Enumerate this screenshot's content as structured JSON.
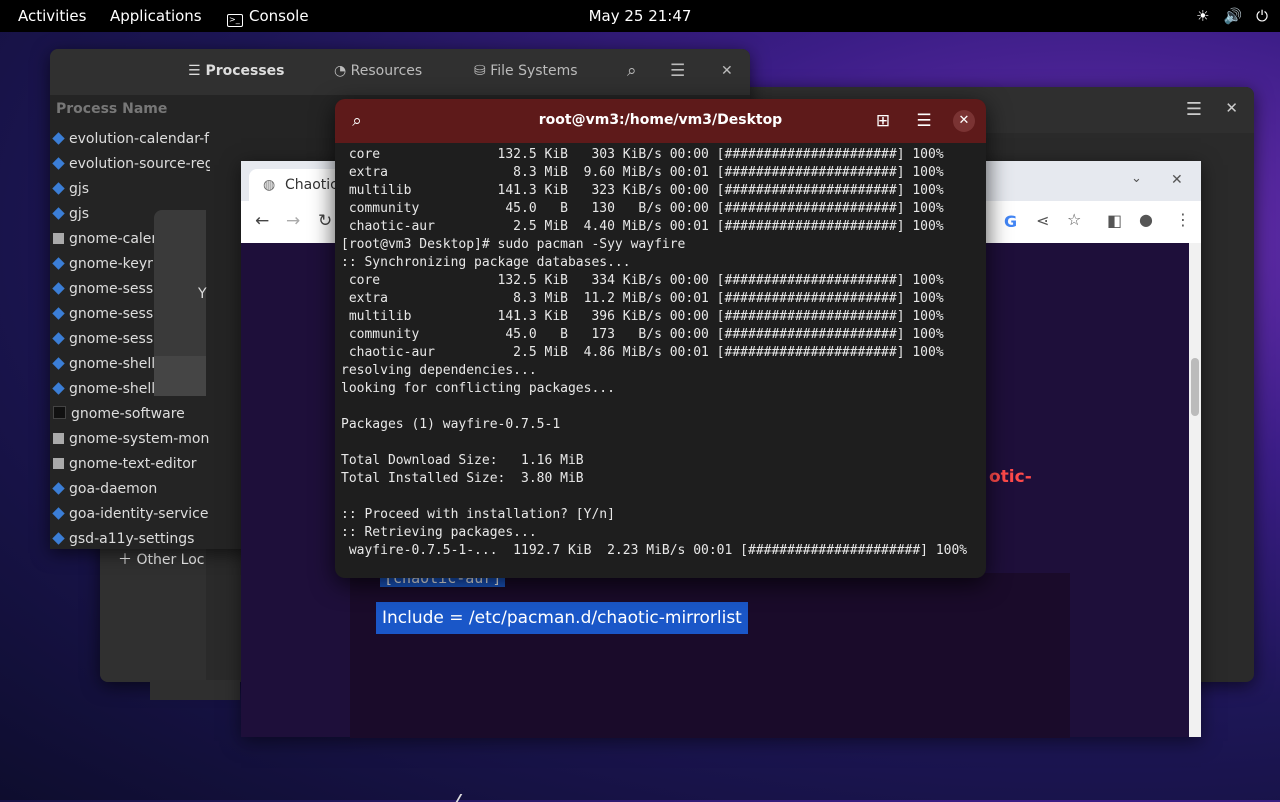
{
  "topbar": {
    "activities": "Activities",
    "applications": "Applications",
    "console": "Console",
    "clock": "May 25  21:47",
    "tray_icons": [
      "brightness-icon",
      "volume-icon",
      "power-icon"
    ]
  },
  "sysmon": {
    "tabs": [
      "Processes",
      "Resources",
      "File Systems"
    ],
    "column_header": "Process Name",
    "processes": [
      {
        "name": "evolution-calendar-f",
        "icon": "diamond"
      },
      {
        "name": "evolution-source-reg",
        "icon": "diamond"
      },
      {
        "name": "gjs",
        "icon": "diamond"
      },
      {
        "name": "gjs",
        "icon": "diamond"
      },
      {
        "name": "gnome-calen",
        "icon": "square"
      },
      {
        "name": "gnome-keyri",
        "icon": "diamond"
      },
      {
        "name": "gnome-sessi",
        "icon": "diamond"
      },
      {
        "name": "gnome-sessi",
        "icon": "diamond"
      },
      {
        "name": "gnome-sessi",
        "icon": "diamond"
      },
      {
        "name": "gnome-shell",
        "icon": "diamond"
      },
      {
        "name": "gnome-shell-c",
        "icon": "diamond"
      },
      {
        "name": "gnome-software",
        "icon": "black"
      },
      {
        "name": "gnome-system-moni",
        "icon": "square"
      },
      {
        "name": "gnome-text-editor",
        "icon": "square"
      },
      {
        "name": "goa-daemon",
        "icon": "diamond"
      },
      {
        "name": "goa-identity-service",
        "icon": "diamond"
      },
      {
        "name": "gsd-a11y-settings",
        "icon": "diamond"
      }
    ]
  },
  "files": {
    "other_locations": "Other Loc",
    "dialog_fragment": "Y"
  },
  "browser": {
    "tab_title": "Chaotic",
    "red_fragment": "otic-",
    "highlight1": "[chaotic-aur]",
    "highlight2": "Include = /etc/pacman.d/chaotic-mirrorlist"
  },
  "terminal": {
    "title": "root@vm3:/home/vm3/Desktop",
    "output": " core               132.5 KiB   303 KiB/s 00:00 [######################] 100%\n extra                8.3 MiB  9.60 MiB/s 00:01 [######################] 100%\n multilib           141.3 KiB   323 KiB/s 00:00 [######################] 100%\n community           45.0   B   130   B/s 00:00 [######################] 100%\n chaotic-aur          2.5 MiB  4.40 MiB/s 00:01 [######################] 100%\n[root@vm3 Desktop]# sudo pacman -Syy wayfire\n:: Synchronizing package databases...\n core               132.5 KiB   334 KiB/s 00:00 [######################] 100%\n extra                8.3 MiB  11.2 MiB/s 00:01 [######################] 100%\n multilib           141.3 KiB   396 KiB/s 00:00 [######################] 100%\n community           45.0   B   173   B/s 00:00 [######################] 100%\n chaotic-aur          2.5 MiB  4.86 MiB/s 00:01 [######################] 100%\nresolving dependencies...\nlooking for conflicting packages...\n\nPackages (1) wayfire-0.7.5-1\n\nTotal Download Size:   1.16 MiB\nTotal Installed Size:  3.80 MiB\n\n:: Proceed with installation? [Y/n]\n:: Retrieving packages...\n wayfire-0.7.5-1-...  1192.7 KiB  2.23 MiB/s 00:01 [######################] 100%"
  }
}
